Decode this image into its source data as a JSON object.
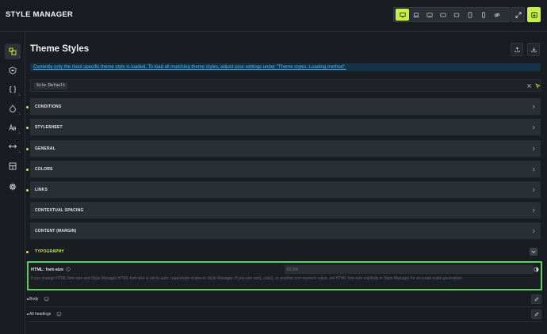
{
  "app": {
    "title": "STYLE MANAGER"
  },
  "toolbar": {
    "devices": [
      "desktop-icon",
      "laptop-icon",
      "tablet-landscape-icon",
      "tablet-icon",
      "tablet-portrait-icon",
      "mobile-landscape-icon",
      "mobile-icon",
      "hide-icon"
    ],
    "active_device": "desktop-icon",
    "accent": "#c7f23b"
  },
  "sidebar": {
    "items": [
      {
        "icon": "theme-styles-icon",
        "count": "1",
        "active": true
      },
      {
        "icon": "shield-icon",
        "count": ""
      },
      {
        "icon": "braces-icon",
        "count": "1"
      },
      {
        "icon": "droplet-icon",
        "count": "1"
      },
      {
        "icon": "typography-icon",
        "count": "1"
      },
      {
        "icon": "spacing-icon",
        "count": "1"
      },
      {
        "icon": "layout-icon",
        "count": ""
      },
      {
        "icon": "gear-icon",
        "count": ""
      }
    ]
  },
  "main": {
    "title": "Theme Styles",
    "notice": "Currently only the most specific theme style is loaded. To load all matching theme styles, adjust your settings under \"Theme styles: Loading method\".",
    "selected_style": "Site Default",
    "sections": [
      {
        "label": "CONDITIONS",
        "modified": true
      },
      {
        "label": "STYLESHEET",
        "modified": true
      },
      {
        "label": "GENERAL",
        "modified": true
      },
      {
        "label": "COLORS",
        "modified": true
      },
      {
        "label": "LINKS",
        "modified": true
      },
      {
        "label": "CONTEXTUAL SPACING",
        "modified": false
      },
      {
        "label": "CONTENT (MARGIN)",
        "modified": false
      },
      {
        "label": "TYPOGRAPHY",
        "modified": true,
        "open": true
      }
    ],
    "typography": {
      "html_font_size": {
        "label": "HTML: font-size",
        "placeholder": "62.5%",
        "description": "If you change HTML font-size and Style Manager HTML font-size is set to auto, regenerate scales in Style Manager. If you use var(), calc(), or another non-numeric value, set HTML font-size explicitly in Style Manager for accurate scale generation."
      },
      "rows": [
        {
          "label": "Body"
        },
        {
          "label": "All headings"
        }
      ]
    }
  }
}
